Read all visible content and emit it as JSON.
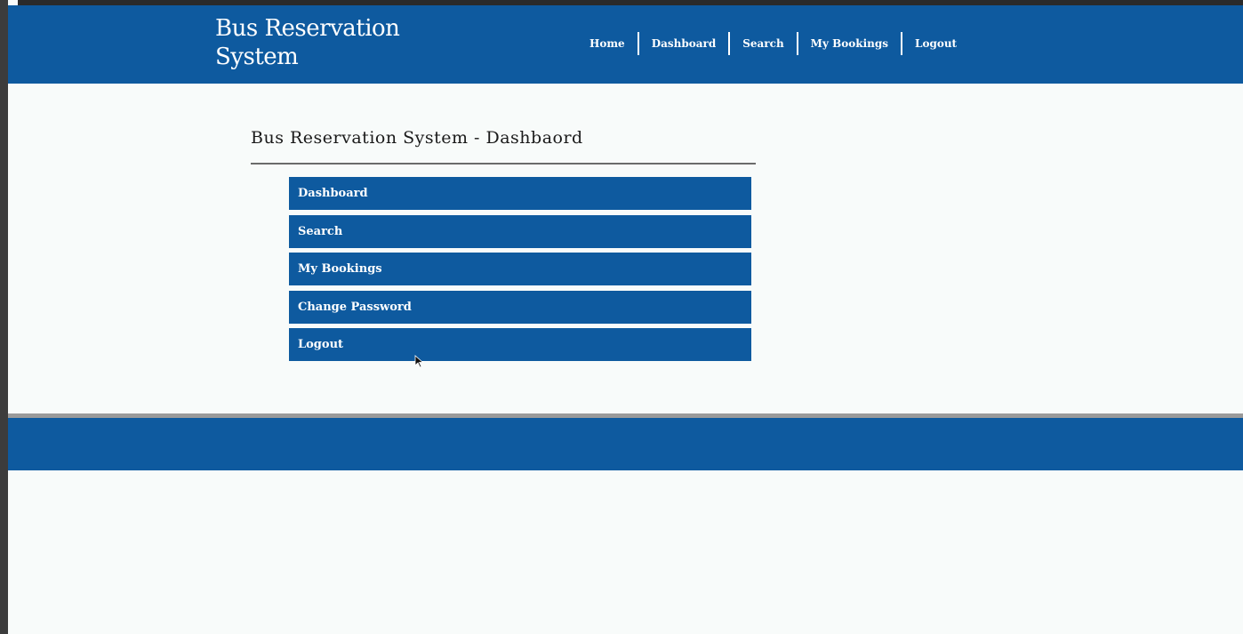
{
  "header": {
    "site_title": "Bus Reservation System",
    "nav": [
      "Home",
      "Dashboard",
      "Search",
      "My Bookings",
      "Logout"
    ]
  },
  "main": {
    "title": "Bus Reservation System - Dashbaord",
    "menu": [
      "Dashboard",
      "Search",
      "My Bookings",
      "Change Password",
      "Logout"
    ]
  },
  "colors": {
    "brand_blue": "#0e5a9f",
    "page_bg": "#f8fbfa"
  },
  "icons": [
    "mouse-cursor-icon"
  ]
}
